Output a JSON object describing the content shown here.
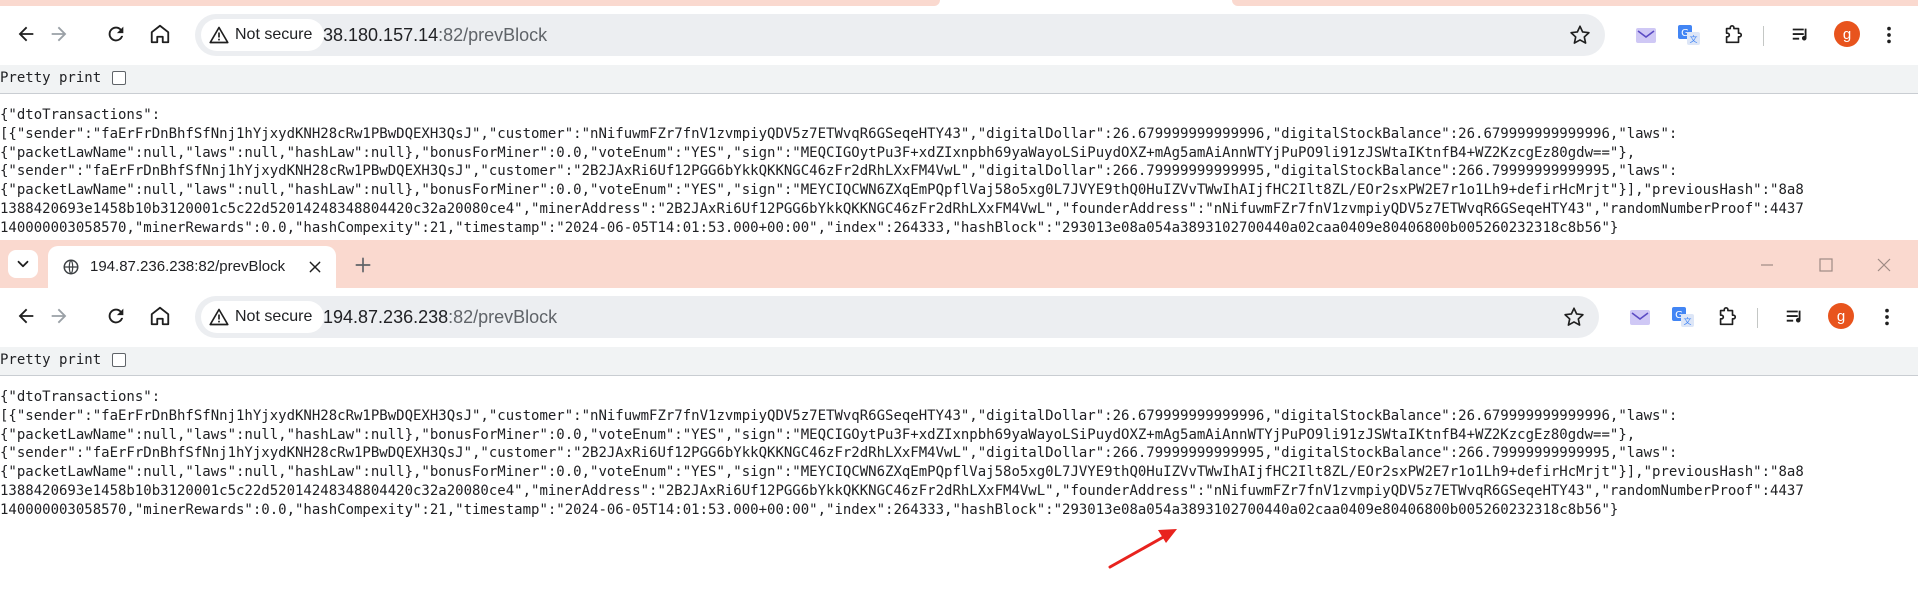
{
  "window1": {
    "security_label": "Not secure",
    "url_host": "38.180.157.14",
    "url_path": ":82/prevBlock",
    "pretty_print_label": "Pretty print",
    "json_lines": [
      "{\"dtoTransactions\":",
      "[{\"sender\":\"faErFrDnBhfSfNnj1hYjxydKNH28cRw1PBwDQEXH3QsJ\",\"customer\":\"nNifuwmFZr7fnV1zvmpiyQDV5z7ETWvqR6GSeqeHTY43\",\"digitalDollar\":26.679999999999996,\"digitalStockBalance\":26.679999999999996,\"laws\":",
      "{\"packetLawName\":null,\"laws\":null,\"hashLaw\":null},\"bonusForMiner\":0.0,\"voteEnum\":\"YES\",\"sign\":\"MEQCIGOytPu3F+xdZIxnpbh69yaWayoLSiPuydOXZ+mAg5amAiAnnWTYjPuPO9li91zJSWtaIKtnfB4+WZ2KzcgEz80gdw==\"},",
      "{\"sender\":\"faErFrDnBhfSfNnj1hYjxydKNH28cRw1PBwDQEXH3QsJ\",\"customer\":\"2B2JAxRi6Uf12PGG6bYkkQKKNGC46zFr2dRhLXxFM4VwL\",\"digitalDollar\":266.79999999999995,\"digitalStockBalance\":266.79999999999995,\"laws\":",
      "{\"packetLawName\":null,\"laws\":null,\"hashLaw\":null},\"bonusForMiner\":0.0,\"voteEnum\":\"YES\",\"sign\":\"MEYCIQCWN6ZXqEmPQpflVaj58o5xg0L7JVYE9thQ0HuIZVvTWwIhAIjfHC2Ilt8ZL/EOr2sxPW2E7r1o1Lh9+defirHcMrjt\"}],\"previousHash\":\"8a8",
      "1388420693e1458b10b3120001c5c22d52014248348804420c32a20080ce4\",\"minerAddress\":\"2B2JAxRi6Uf12PGG6bYkkQKKNGC46zFr2dRhLXxFM4VwL\",\"founderAddress\":\"nNifuwmFZr7fnV1zvmpiyQDV5z7ETWvqR6GSeqeHTY43\",\"randomNumberProof\":4437",
      "140000003058570,\"minerRewards\":0.0,\"hashCompexity\":21,\"timestamp\":\"2024-06-05T14:01:53.000+00:00\",\"index\":264333,\"hashBlock\":\"293013e08a054a3893102700440a02caa0409e80406800b005260232318c8b56\"}"
    ]
  },
  "window2": {
    "tab_title": "194.87.236.238:82/prevBlock",
    "security_label": "Not secure",
    "url_host": "194.87.236.238",
    "url_path": ":82/prevBlock",
    "pretty_print_label": "Pretty print",
    "json_lines": [
      "{\"dtoTransactions\":",
      "[{\"sender\":\"faErFrDnBhfSfNnj1hYjxydKNH28cRw1PBwDQEXH3QsJ\",\"customer\":\"nNifuwmFZr7fnV1zvmpiyQDV5z7ETWvqR6GSeqeHTY43\",\"digitalDollar\":26.679999999999996,\"digitalStockBalance\":26.679999999999996,\"laws\":",
      "{\"packetLawName\":null,\"laws\":null,\"hashLaw\":null},\"bonusForMiner\":0.0,\"voteEnum\":\"YES\",\"sign\":\"MEQCIGOytPu3F+xdZIxnpbh69yaWayoLSiPuydOXZ+mAg5amAiAnnWTYjPuPO9li91zJSWtaIKtnfB4+WZ2KzcgEz80gdw==\"},",
      "{\"sender\":\"faErFrDnBhfSfNnj1hYjxydKNH28cRw1PBwDQEXH3QsJ\",\"customer\":\"2B2JAxRi6Uf12PGG6bYkkQKKNGC46zFr2dRhLXxFM4VwL\",\"digitalDollar\":266.79999999999995,\"digitalStockBalance\":266.79999999999995,\"laws\":",
      "{\"packetLawName\":null,\"laws\":null,\"hashLaw\":null},\"bonusForMiner\":0.0,\"voteEnum\":\"YES\",\"sign\":\"MEYCIQCWN6ZXqEmPQpflVaj58o5xg0L7JVYE9thQ0HuIZVvTWwIhAIjfHC2Ilt8ZL/EOr2sxPW2E7r1o1Lh9+defirHcMrjt\"}],\"previousHash\":\"8a8",
      "1388420693e1458b10b3120001c5c22d52014248348804420c32a20080ce4\",\"minerAddress\":\"2B2JAxRi6Uf12PGG6bYkkQKKNGC46zFr2dRhLXxFM4VwL\",\"founderAddress\":\"nNifuwmFZr7fnV1zvmpiyQDV5z7ETWvqR6GSeqeHTY43\",\"randomNumberProof\":4437",
      "140000003058570,\"minerRewards\":0.0,\"hashCompexity\":21,\"timestamp\":\"2024-06-05T14:01:53.000+00:00\",\"index\":264333,\"hashBlock\":\"293013e08a054a3893102700440a02caa0409e80406800b005260232318c8b56\"}"
    ]
  },
  "icons": {
    "back": "arrow-left-icon",
    "forward": "arrow-right-icon",
    "reload": "reload-icon",
    "home": "home-icon",
    "warning": "warning-triangle-icon",
    "bookmark": "star-icon",
    "extension_1": "envelope-ai-icon",
    "extension_2": "translate-icon",
    "extensions": "puzzle-icon",
    "media": "media-queue-icon",
    "menu": "kebab-menu-icon"
  },
  "profile_initial": "g",
  "colors": {
    "tab_strip": "#fad9cf",
    "omnibox": "#eceef1",
    "annotation_arrow": "#e8231e",
    "avatar": "#e8541d"
  }
}
